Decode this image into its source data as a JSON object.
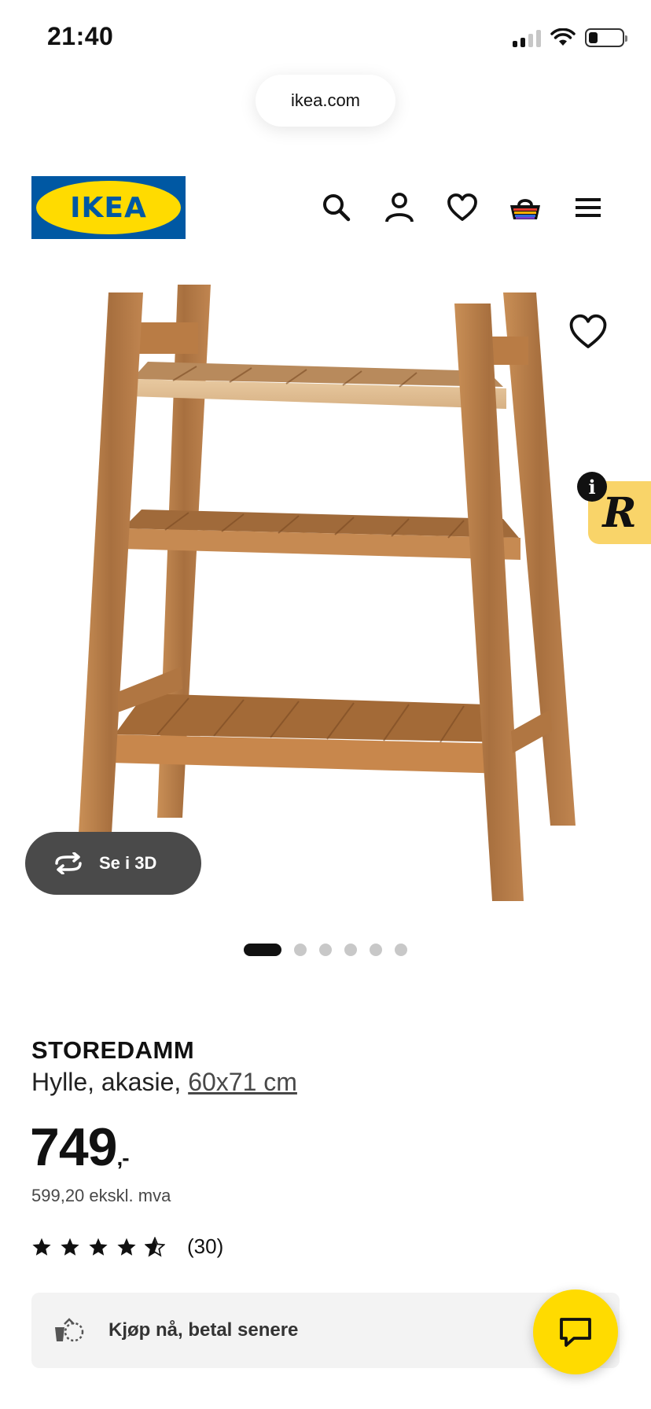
{
  "status_bar": {
    "time": "21:40"
  },
  "browser": {
    "url": "ikea.com"
  },
  "header": {
    "logo_text": "IKEA",
    "icons": [
      "search-icon",
      "account-icon",
      "heart-icon",
      "shopping-bag-icon",
      "menu-icon"
    ]
  },
  "gallery": {
    "view_3d_label": "Se i 3D",
    "slide_count": 6,
    "active_slide": 1
  },
  "product": {
    "name": "STOREDAMM",
    "description": "Hylle, akasie, ",
    "size": "60x71 cm",
    "price": "749",
    "price_suffix": ",-",
    "price_ex_vat": "599,20 ekskl. mva",
    "rating_stars": 4.5,
    "rating_count": "(30)"
  },
  "banner": {
    "label": "Kjøp nå, betal senere"
  },
  "colors": {
    "ikea_blue": "#0058a3",
    "ikea_yellow": "#ffdb00",
    "badge_yellow": "#f9d469"
  }
}
